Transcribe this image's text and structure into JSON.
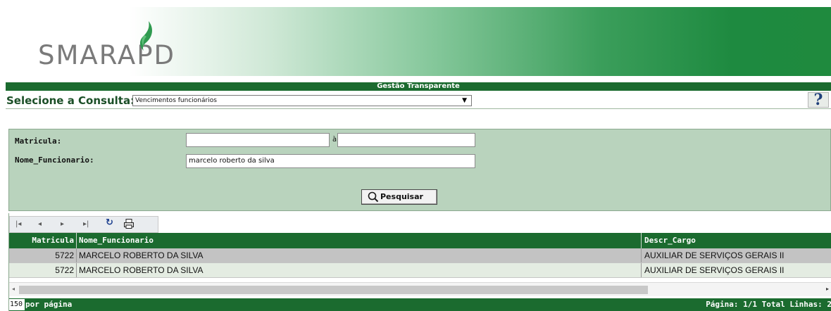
{
  "header": {
    "logo_text": "SMARAPD"
  },
  "title_bar": {
    "title": "Gestão Transparente"
  },
  "query_select": {
    "label": "Selecione a Consulta:",
    "value": "Vencimentos funcionários",
    "arrow": "▼",
    "help_label": "?"
  },
  "filters": {
    "matricula_label": "Matricula:",
    "matricula_from": "",
    "range_separator": "à",
    "matricula_to": "",
    "nome_label": "Nome_Funcionario:",
    "nome_value": "marcelo roberto da silva",
    "search_button": "Pesquisar"
  },
  "toolbar": {
    "first": "|◂",
    "prev": "◂",
    "next": "▸",
    "last": "▸|",
    "refresh": "↻",
    "print": "🖶"
  },
  "table": {
    "columns": [
      "Matricula",
      "Nome_Funcionario",
      "Descr_Cargo"
    ],
    "rows": [
      {
        "matricula": "5722",
        "nome": "MARCELO ROBERTO DA SILVA",
        "cargo": "AUXILIAR DE SERVIÇOS GERAIS II"
      },
      {
        "matricula": "5722",
        "nome": "MARCELO ROBERTO DA SILVA",
        "cargo": "AUXILIAR DE SERVIÇOS GERAIS II"
      }
    ]
  },
  "scrollbar": {
    "left_arrow": "◂",
    "right_arrow": "▸"
  },
  "footer": {
    "per_page_value": "150",
    "per_page_label": "por página",
    "page_info": "Página: 1/1 Total Linhas: 2"
  },
  "colors": {
    "brand_green": "#1b6b2f",
    "panel_green": "#b9d3bd"
  }
}
